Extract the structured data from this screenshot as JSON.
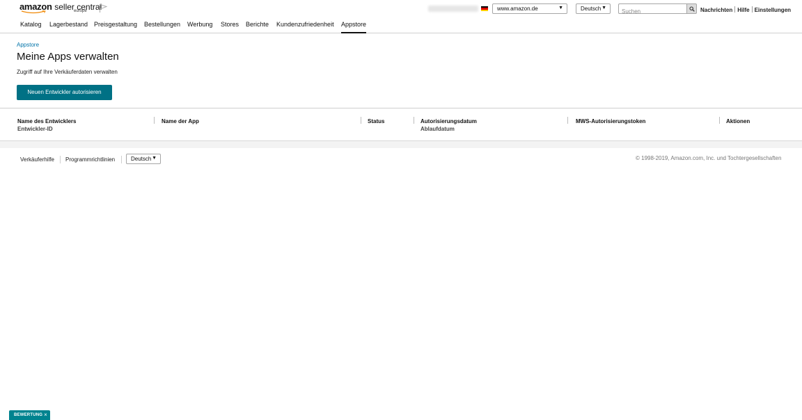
{
  "header": {
    "logo_text_bold": "amazon",
    "logo_text": "seller central",
    "logo_sub": "europe",
    "account_name": "seller-account-eu",
    "marketplace": "www.amazon.de",
    "language": "Deutsch",
    "search_placeholder": "Suchen",
    "links": [
      "Nachrichten",
      "Hilfe",
      "Einstellungen"
    ]
  },
  "nav": {
    "items": [
      "Katalog",
      "Lagerbestand",
      "Preisgestaltung",
      "Bestellungen",
      "Werbung",
      "Stores",
      "Berichte",
      "Kundenzufriedenheit",
      "Appstore"
    ],
    "active": "Appstore"
  },
  "page": {
    "breadcrumb": "Appstore",
    "title": "Meine Apps verwalten",
    "subtitle": "Zugriff auf Ihre Verkäuferdaten verwalten",
    "primary_button": "Neuen Entwickler autorisieren"
  },
  "table": {
    "columns": [
      {
        "label": "Name des Entwicklers",
        "sub": "Entwickler-ID"
      },
      {
        "label": "Name der App",
        "sub": ""
      },
      {
        "label": "Status",
        "sub": ""
      },
      {
        "label": "Autorisierungsdatum",
        "sub": "Ablaufdatum"
      },
      {
        "label": "MWS-Autorisierungstoken",
        "sub": ""
      },
      {
        "label": "Aktionen",
        "sub": ""
      }
    ],
    "rows": []
  },
  "footer": {
    "links": [
      "Verkäuferhilfe",
      "Programmrichtlinien"
    ],
    "language": "Deutsch",
    "copyright": "© 1998-2019, Amazon.com, Inc. und Tochtergesellschaften"
  },
  "feedback": {
    "label": "BEWERTUNG",
    "close": "×"
  },
  "colors": {
    "primary_button": "#007185",
    "link": "#0073a8",
    "feedback_tab": "#00838f"
  },
  "icons": [
    "amazon-smile-icon",
    "flag-icon",
    "germany-flag-icon",
    "dropdown-arrow-icon",
    "search-icon",
    "close-icon"
  ]
}
